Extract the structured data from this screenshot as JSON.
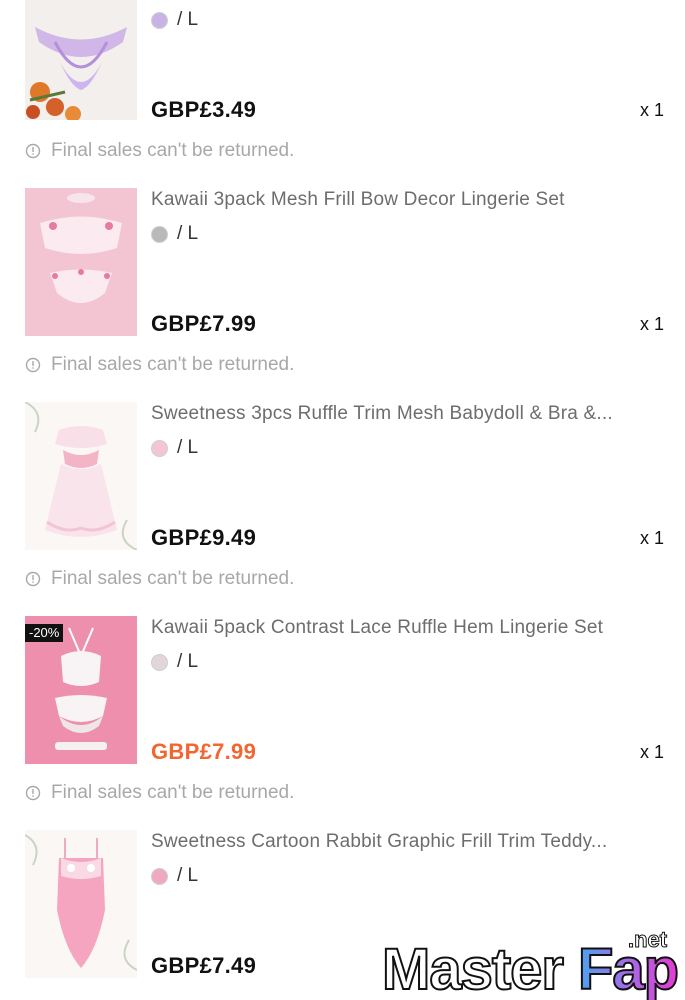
{
  "items": [
    {
      "title": "",
      "variant": "/ L",
      "swatch_color": "#c9b3e6",
      "price": "GBP£3.49",
      "price_color": "#111111",
      "quantity": "x 1",
      "notice": "Final sales can't be returned.",
      "badge": ""
    },
    {
      "title": "Kawaii 3pack Mesh Frill Bow Decor Lingerie Set",
      "variant": "/ L",
      "swatch_color": "#b9b9b9",
      "price": "GBP£7.99",
      "price_color": "#111111",
      "quantity": "x 1",
      "notice": "Final sales can't be returned.",
      "badge": ""
    },
    {
      "title": "Sweetness 3pcs Ruffle Trim Mesh Babydoll & Bra &...",
      "variant": "/ L",
      "swatch_color": "#f4c6d4",
      "price": "GBP£9.49",
      "price_color": "#111111",
      "quantity": "x 1",
      "notice": "Final sales can't be returned.",
      "badge": ""
    },
    {
      "title": "Kawaii 5pack Contrast Lace Ruffle Hem Lingerie Set",
      "variant": "/ L",
      "swatch_color": "#e2d6da",
      "price": "GBP£7.99",
      "price_color": "#f2662f",
      "quantity": "x 1",
      "notice": "Final sales can't be returned.",
      "badge": "-20%"
    },
    {
      "title": "Sweetness Cartoon Rabbit Graphic Frill Trim Teddy...",
      "variant": "/ L",
      "swatch_color": "#f0a9c2",
      "price": "GBP£7.49",
      "price_color": "#111111",
      "quantity": "",
      "notice": "",
      "badge": ""
    }
  ],
  "watermark": {
    "text": "MasterFap",
    "suffix": ".net"
  },
  "icons": {
    "notice": "info-circle-icon"
  }
}
